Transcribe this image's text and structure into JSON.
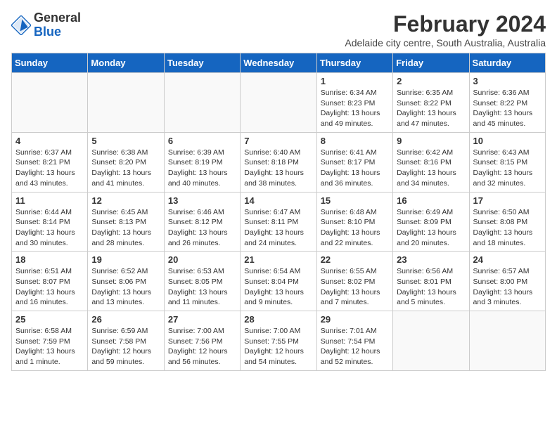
{
  "logo": {
    "general": "General",
    "blue": "Blue"
  },
  "title": "February 2024",
  "subtitle": "Adelaide city centre, South Australia, Australia",
  "days_of_week": [
    "Sunday",
    "Monday",
    "Tuesday",
    "Wednesday",
    "Thursday",
    "Friday",
    "Saturday"
  ],
  "weeks": [
    [
      {
        "day": "",
        "info": ""
      },
      {
        "day": "",
        "info": ""
      },
      {
        "day": "",
        "info": ""
      },
      {
        "day": "",
        "info": ""
      },
      {
        "day": "1",
        "info": "Sunrise: 6:34 AM\nSunset: 8:23 PM\nDaylight: 13 hours and 49 minutes."
      },
      {
        "day": "2",
        "info": "Sunrise: 6:35 AM\nSunset: 8:22 PM\nDaylight: 13 hours and 47 minutes."
      },
      {
        "day": "3",
        "info": "Sunrise: 6:36 AM\nSunset: 8:22 PM\nDaylight: 13 hours and 45 minutes."
      }
    ],
    [
      {
        "day": "4",
        "info": "Sunrise: 6:37 AM\nSunset: 8:21 PM\nDaylight: 13 hours and 43 minutes."
      },
      {
        "day": "5",
        "info": "Sunrise: 6:38 AM\nSunset: 8:20 PM\nDaylight: 13 hours and 41 minutes."
      },
      {
        "day": "6",
        "info": "Sunrise: 6:39 AM\nSunset: 8:19 PM\nDaylight: 13 hours and 40 minutes."
      },
      {
        "day": "7",
        "info": "Sunrise: 6:40 AM\nSunset: 8:18 PM\nDaylight: 13 hours and 38 minutes."
      },
      {
        "day": "8",
        "info": "Sunrise: 6:41 AM\nSunset: 8:17 PM\nDaylight: 13 hours and 36 minutes."
      },
      {
        "day": "9",
        "info": "Sunrise: 6:42 AM\nSunset: 8:16 PM\nDaylight: 13 hours and 34 minutes."
      },
      {
        "day": "10",
        "info": "Sunrise: 6:43 AM\nSunset: 8:15 PM\nDaylight: 13 hours and 32 minutes."
      }
    ],
    [
      {
        "day": "11",
        "info": "Sunrise: 6:44 AM\nSunset: 8:14 PM\nDaylight: 13 hours and 30 minutes."
      },
      {
        "day": "12",
        "info": "Sunrise: 6:45 AM\nSunset: 8:13 PM\nDaylight: 13 hours and 28 minutes."
      },
      {
        "day": "13",
        "info": "Sunrise: 6:46 AM\nSunset: 8:12 PM\nDaylight: 13 hours and 26 minutes."
      },
      {
        "day": "14",
        "info": "Sunrise: 6:47 AM\nSunset: 8:11 PM\nDaylight: 13 hours and 24 minutes."
      },
      {
        "day": "15",
        "info": "Sunrise: 6:48 AM\nSunset: 8:10 PM\nDaylight: 13 hours and 22 minutes."
      },
      {
        "day": "16",
        "info": "Sunrise: 6:49 AM\nSunset: 8:09 PM\nDaylight: 13 hours and 20 minutes."
      },
      {
        "day": "17",
        "info": "Sunrise: 6:50 AM\nSunset: 8:08 PM\nDaylight: 13 hours and 18 minutes."
      }
    ],
    [
      {
        "day": "18",
        "info": "Sunrise: 6:51 AM\nSunset: 8:07 PM\nDaylight: 13 hours and 16 minutes."
      },
      {
        "day": "19",
        "info": "Sunrise: 6:52 AM\nSunset: 8:06 PM\nDaylight: 13 hours and 13 minutes."
      },
      {
        "day": "20",
        "info": "Sunrise: 6:53 AM\nSunset: 8:05 PM\nDaylight: 13 hours and 11 minutes."
      },
      {
        "day": "21",
        "info": "Sunrise: 6:54 AM\nSunset: 8:04 PM\nDaylight: 13 hours and 9 minutes."
      },
      {
        "day": "22",
        "info": "Sunrise: 6:55 AM\nSunset: 8:02 PM\nDaylight: 13 hours and 7 minutes."
      },
      {
        "day": "23",
        "info": "Sunrise: 6:56 AM\nSunset: 8:01 PM\nDaylight: 13 hours and 5 minutes."
      },
      {
        "day": "24",
        "info": "Sunrise: 6:57 AM\nSunset: 8:00 PM\nDaylight: 13 hours and 3 minutes."
      }
    ],
    [
      {
        "day": "25",
        "info": "Sunrise: 6:58 AM\nSunset: 7:59 PM\nDaylight: 13 hours and 1 minute."
      },
      {
        "day": "26",
        "info": "Sunrise: 6:59 AM\nSunset: 7:58 PM\nDaylight: 12 hours and 59 minutes."
      },
      {
        "day": "27",
        "info": "Sunrise: 7:00 AM\nSunset: 7:56 PM\nDaylight: 12 hours and 56 minutes."
      },
      {
        "day": "28",
        "info": "Sunrise: 7:00 AM\nSunset: 7:55 PM\nDaylight: 12 hours and 54 minutes."
      },
      {
        "day": "29",
        "info": "Sunrise: 7:01 AM\nSunset: 7:54 PM\nDaylight: 12 hours and 52 minutes."
      },
      {
        "day": "",
        "info": ""
      },
      {
        "day": "",
        "info": ""
      }
    ]
  ]
}
